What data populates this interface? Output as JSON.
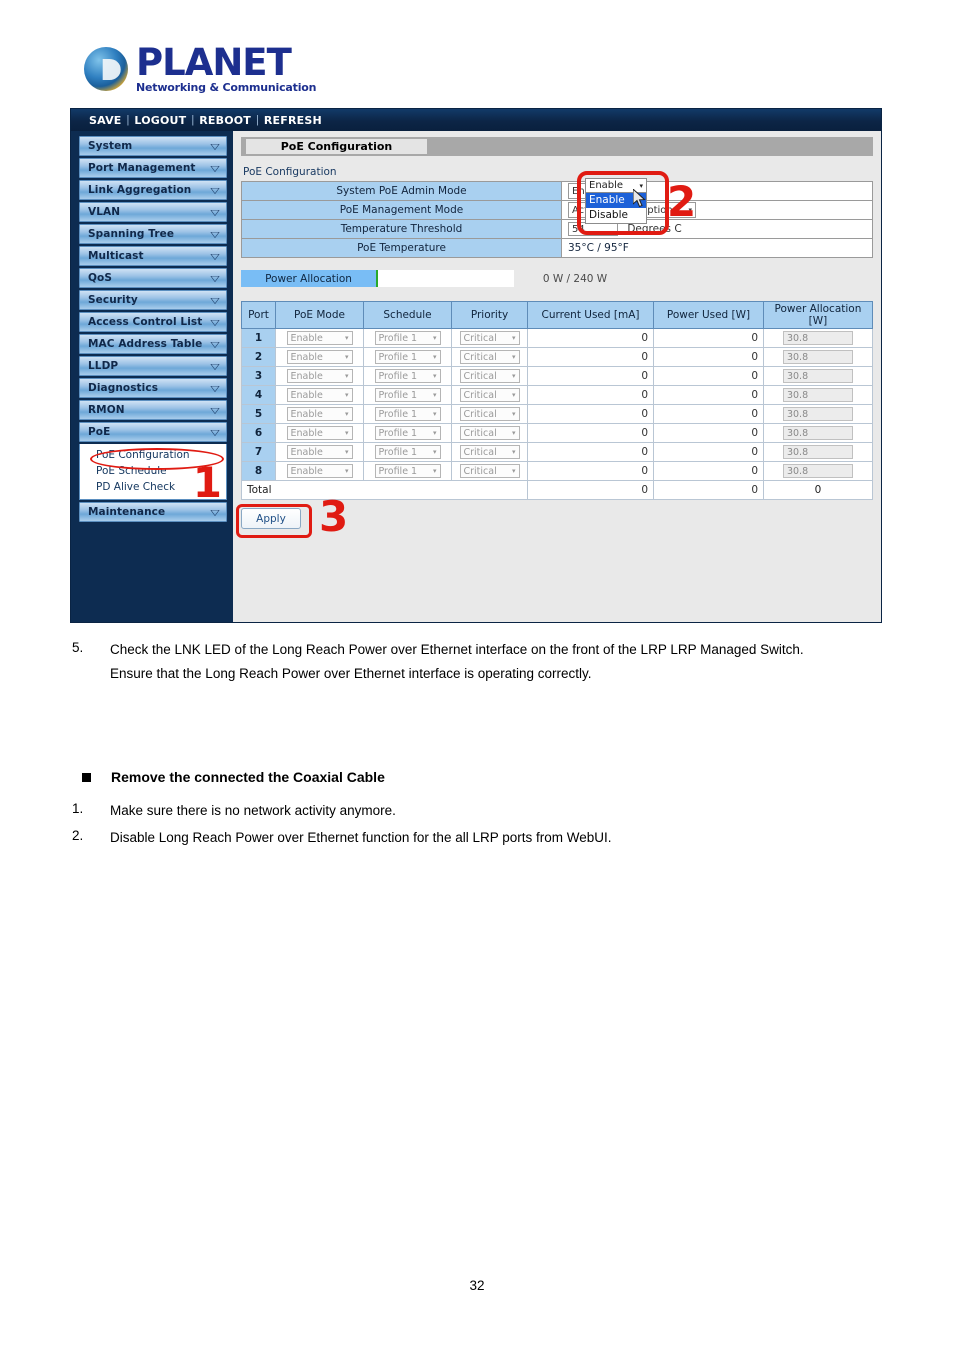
{
  "brand": {
    "name": "PLANET",
    "tagline": "Networking & Communication"
  },
  "webui": {
    "topbar": {
      "save": "SAVE",
      "logout": "LOGOUT",
      "reboot": "REBOOT",
      "refresh": "REFRESH",
      "separator": "|"
    },
    "sidebar": {
      "items": [
        {
          "label": "System",
          "caret": "▽"
        },
        {
          "label": "Port Management",
          "caret": "▽"
        },
        {
          "label": "Link Aggregation",
          "caret": "▽"
        },
        {
          "label": "VLAN",
          "caret": "▽"
        },
        {
          "label": "Spanning Tree",
          "caret": "▽"
        },
        {
          "label": "Multicast",
          "caret": "▽"
        },
        {
          "label": "QoS",
          "caret": "▽"
        },
        {
          "label": "Security",
          "caret": "▽"
        },
        {
          "label": "Access Control List",
          "caret": "▽"
        },
        {
          "label": "MAC Address Table",
          "caret": "▽"
        },
        {
          "label": "LLDP",
          "caret": "▽"
        },
        {
          "label": "Diagnostics",
          "caret": "▽"
        },
        {
          "label": "RMON",
          "caret": "▽"
        },
        {
          "label": "PoE",
          "caret": "▽"
        }
      ],
      "submenu": [
        {
          "label": "PoE Configuration",
          "selected": true
        },
        {
          "label": "PoE Schedule",
          "selected": false
        },
        {
          "label": "PD Alive Check",
          "selected": false
        }
      ],
      "last_item": {
        "label": "Maintenance",
        "caret": "▽"
      }
    },
    "page_title": "PoE Configuration",
    "section_label": "PoE Configuration",
    "config_rows": [
      {
        "label": "System PoE Admin Mode",
        "type": "select",
        "value": "Enable"
      },
      {
        "label": "PoE Management Mode",
        "type": "select",
        "value": "Actual Consumption"
      },
      {
        "label": "Temperature Threshold",
        "type": "text",
        "value": "54",
        "unit": "Degrees C"
      },
      {
        "label": "PoE Temperature",
        "type": "static",
        "value": "35°C / 95°F"
      }
    ],
    "dropdown": {
      "closed_value": "Enable",
      "arrow": "▾",
      "options": [
        {
          "label": "Enable",
          "highlighted": true
        },
        {
          "label": "Disable",
          "highlighted": false
        }
      ]
    },
    "power_allocation": {
      "label": "Power Allocation",
      "reading": "0 W / 240 W",
      "used_w": 0,
      "total_w": 240,
      "percent": 0
    },
    "ports_table": {
      "headers": [
        "Port",
        "PoE Mode",
        "Schedule",
        "Priority",
        "Current Used [mA]",
        "Power Used [W]",
        "Power Allocation [W]"
      ],
      "rows": [
        {
          "port": "1",
          "poe_mode": "Enable",
          "schedule": "Profile 1",
          "priority": "Critical",
          "current_used": "0",
          "power_used": "0",
          "power_alloc": "30.8"
        },
        {
          "port": "2",
          "poe_mode": "Enable",
          "schedule": "Profile 1",
          "priority": "Critical",
          "current_used": "0",
          "power_used": "0",
          "power_alloc": "30.8"
        },
        {
          "port": "3",
          "poe_mode": "Enable",
          "schedule": "Profile 1",
          "priority": "Critical",
          "current_used": "0",
          "power_used": "0",
          "power_alloc": "30.8"
        },
        {
          "port": "4",
          "poe_mode": "Enable",
          "schedule": "Profile 1",
          "priority": "Critical",
          "current_used": "0",
          "power_used": "0",
          "power_alloc": "30.8"
        },
        {
          "port": "5",
          "poe_mode": "Enable",
          "schedule": "Profile 1",
          "priority": "Critical",
          "current_used": "0",
          "power_used": "0",
          "power_alloc": "30.8"
        },
        {
          "port": "6",
          "poe_mode": "Enable",
          "schedule": "Profile 1",
          "priority": "Critical",
          "current_used": "0",
          "power_used": "0",
          "power_alloc": "30.8"
        },
        {
          "port": "7",
          "poe_mode": "Enable",
          "schedule": "Profile 1",
          "priority": "Critical",
          "current_used": "0",
          "power_used": "0",
          "power_alloc": "30.8"
        },
        {
          "port": "8",
          "poe_mode": "Enable",
          "schedule": "Profile 1",
          "priority": "Critical",
          "current_used": "0",
          "power_used": "0",
          "power_alloc": "30.8"
        }
      ],
      "total": {
        "label": "Total",
        "current_used": "0",
        "power_used": "0",
        "power_alloc": "0"
      }
    },
    "apply_label": "Apply",
    "callouts": [
      {
        "number": "1"
      },
      {
        "number": "2"
      },
      {
        "number": "3"
      }
    ],
    "colors": {
      "annotation_red": "#e01b12",
      "header_navy": "#0d2c51",
      "row_blue": "#a9d0f0",
      "dropdown_highlight": "#1d61d8",
      "power_bar_green": "#2aa92a"
    }
  },
  "document": {
    "step5": {
      "number": "5.",
      "text": "Check the LNK LED of the Long Reach Power over Ethernet interface on the front of the LRP LRP Managed Switch.",
      "followup": "Ensure that the Long Reach Power over Ethernet interface is operating correctly."
    },
    "section_heading": "Remove the connected the Coaxial Cable",
    "steps": [
      {
        "number": "1.",
        "text": "Make sure there is no network activity anymore."
      },
      {
        "number": "2.",
        "text": "Disable Long Reach Power over Ethernet function for the all LRP ports from WebUI."
      }
    ],
    "page_number": "32"
  }
}
